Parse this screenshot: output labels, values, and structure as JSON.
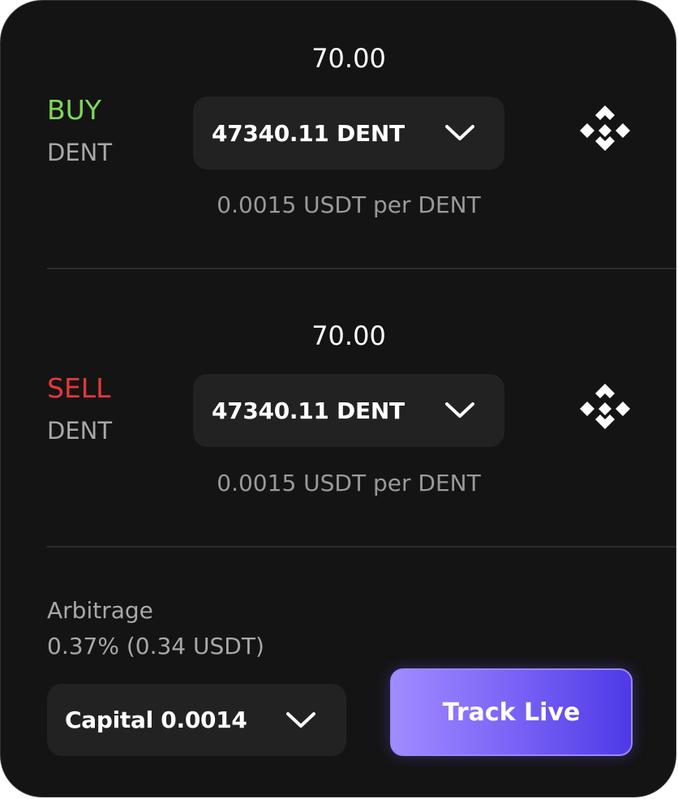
{
  "buy": {
    "amount": "70.00",
    "side_label": "BUY",
    "asset": "DENT",
    "selector_value": "47340.11 DENT",
    "rate": "0.0015 USDT per DENT",
    "exchange_icon": "binance-logo-icon",
    "color": "#7ed957"
  },
  "sell": {
    "amount": "70.00",
    "side_label": "SELL",
    "asset": "DENT",
    "selector_value": "47340.11 DENT",
    "rate": "0.0015 USDT per DENT",
    "exchange_icon": "binance-logo-icon",
    "color": "#e5373a"
  },
  "arbitrage": {
    "label": "Arbitrage",
    "value": "0.37% (0.34 USDT)"
  },
  "capital": {
    "label": "Capital 0.0014"
  },
  "actions": {
    "track_live": "Track Live",
    "accent": "#7b63f6"
  }
}
